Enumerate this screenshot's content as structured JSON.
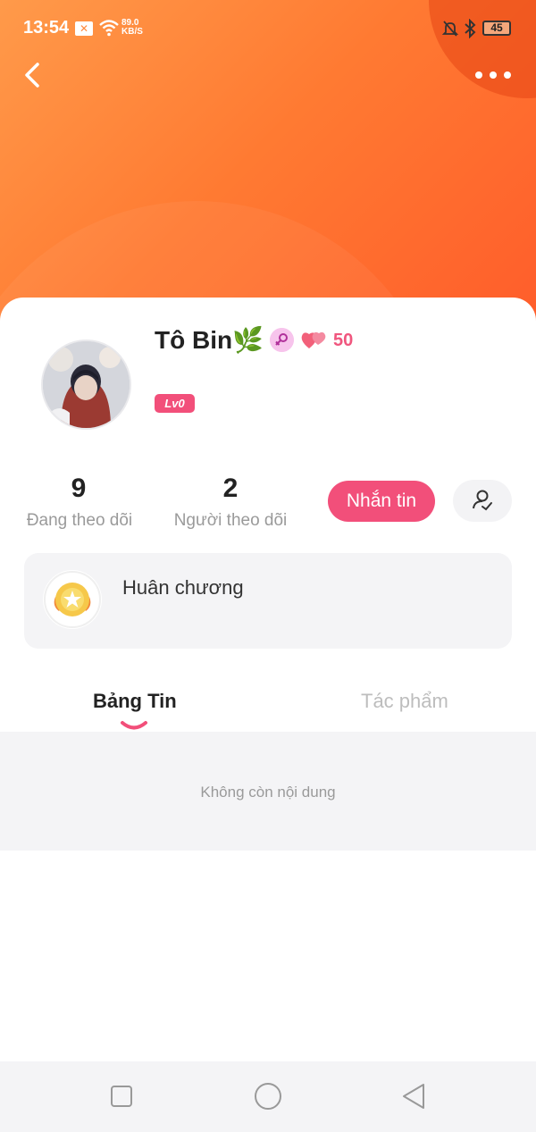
{
  "status_bar": {
    "time": "13:54",
    "net_speed_value": "89.0",
    "net_speed_unit": "KB/S",
    "battery": "45",
    "notif_icon": "x-icon"
  },
  "header": {
    "back_icon": "chevron-left-icon",
    "more_icon": "more-dots-icon",
    "gradient_colors": [
      "#ff9a4a",
      "#ff5a2a"
    ]
  },
  "profile": {
    "username": "Tô Bin🌿",
    "gender_icon": "female-symbol-icon",
    "hearts_icon": "hearts-icon",
    "hearts_count": "50",
    "level": "Lv0"
  },
  "stats": {
    "following_count": "9",
    "following_label": "Đang theo dõi",
    "followers_count": "2",
    "followers_label": "Người theo dõi"
  },
  "actions": {
    "message_label": "Nhắn tin",
    "follow_icon": "user-check-icon",
    "accent_color": "#f24f7a"
  },
  "medal": {
    "label": "Huân chương",
    "icon": "gold-medal-icon"
  },
  "tabs": [
    {
      "label": "Bảng Tin",
      "active": true
    },
    {
      "label": "Tác phẩm",
      "active": false
    }
  ],
  "feed": {
    "empty_text": "Không còn nội dung"
  },
  "nav": {
    "recent_icon": "square-icon",
    "home_icon": "circle-icon",
    "back_icon": "triangle-back-icon"
  }
}
